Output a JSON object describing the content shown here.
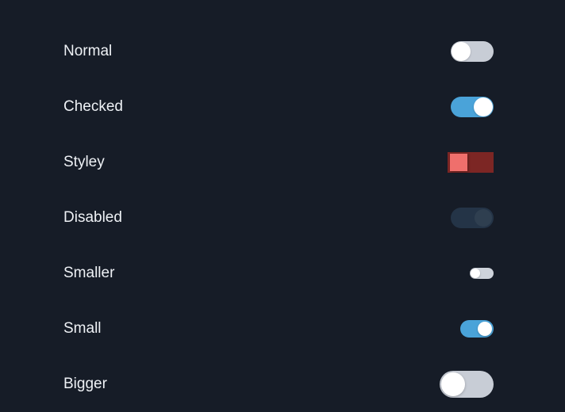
{
  "toggles": {
    "normal": {
      "label": "Normal",
      "checked": false,
      "disabled": false,
      "size": "default",
      "style": "round"
    },
    "checked": {
      "label": "Checked",
      "checked": true,
      "disabled": false,
      "size": "default",
      "style": "round"
    },
    "styley": {
      "label": "Styley",
      "checked": false,
      "disabled": false,
      "size": "default",
      "style": "square",
      "track_color": "#7c2624",
      "knob_color": "#ef6f6c"
    },
    "disabled": {
      "label": "Disabled",
      "checked": true,
      "disabled": true,
      "size": "default",
      "style": "round"
    },
    "smaller": {
      "label": "Smaller",
      "checked": false,
      "disabled": false,
      "size": "smaller",
      "style": "round"
    },
    "small": {
      "label": "Small",
      "checked": true,
      "disabled": false,
      "size": "small",
      "style": "round"
    },
    "bigger": {
      "label": "Bigger",
      "checked": false,
      "disabled": false,
      "size": "bigger",
      "style": "round"
    }
  },
  "colors": {
    "on": "#4aa3d9",
    "off": "#c8cdd6",
    "bg": "#161c27",
    "text": "#eef1f5"
  }
}
